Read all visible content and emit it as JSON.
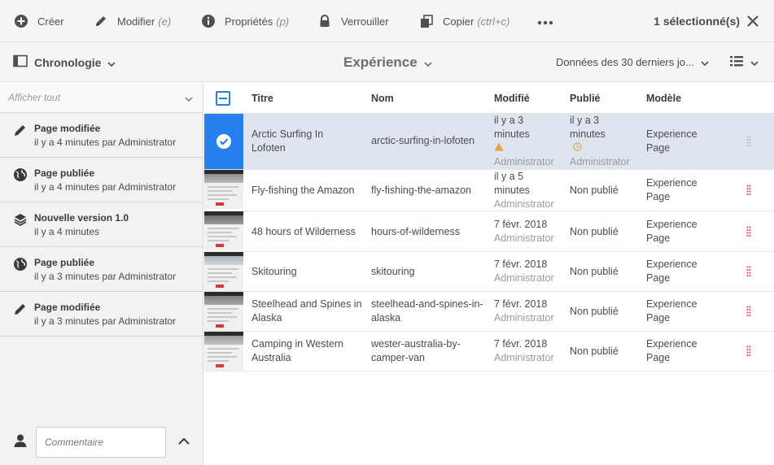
{
  "actionbar": {
    "create": {
      "label": "Créer",
      "shortcut": ""
    },
    "edit": {
      "label": "Modifier",
      "shortcut": "(e)"
    },
    "properties": {
      "label": "Propriétés",
      "shortcut": "(p)"
    },
    "lock": {
      "label": "Verrouiller",
      "shortcut": ""
    },
    "copy": {
      "label": "Copier",
      "shortcut": "(ctrl+c)"
    },
    "more_icon": "more-icon",
    "selection_count": "1 sélectionné(s)",
    "close_icon": "close-icon"
  },
  "subbar": {
    "rail_label": "Chronologie",
    "breadcrumb": "Expérience",
    "date_filter": "Données des 30 derniers jo...",
    "view_icon": "list-view-icon"
  },
  "rail": {
    "filter_label": "Afficher tout",
    "events": [
      {
        "icon": "pencil-icon",
        "title": "Page modifiée",
        "detail": "il y a 4 minutes par Administrator"
      },
      {
        "icon": "globe-icon",
        "title": "Page publiée",
        "detail": "il y a 4 minutes par Administrator"
      },
      {
        "icon": "layers-icon",
        "title": "Nouvelle version 1.0",
        "detail": "il y a 4 minutes"
      },
      {
        "icon": "globe-icon",
        "title": "Page publiée",
        "detail": "il y a 3 minutes par Administrator"
      },
      {
        "icon": "pencil-icon",
        "title": "Page modifiée",
        "detail": "il y a 3 minutes par Administrator"
      }
    ],
    "comment_placeholder": "Commentaire"
  },
  "table": {
    "headers": {
      "title": "Titre",
      "name": "Nom",
      "modified": "Modifié",
      "published": "Publié",
      "template": "Modèle"
    },
    "rows": [
      {
        "title1": "Arctic Surfing In",
        "title2": "Lofoten",
        "name1": "arctic-surfing-in-lofoten",
        "name2": "",
        "mod1": "il y a 3",
        "mod2": "minutes",
        "mod_by": "Administrator",
        "pub1": "il y a 3",
        "pub2": "minutes",
        "pub_by": "Administrator",
        "tpl1": "Experience",
        "tpl2": "Page"
      },
      {
        "title1": "Fly-fishing the Amazon",
        "title2": "",
        "name1": "fly-fishing-the-amazon",
        "name2": "",
        "mod1": "il y a 5",
        "mod2": "minutes",
        "mod_by": "Administrator",
        "pub": "Non publié",
        "tpl1": "Experience",
        "tpl2": "Page"
      },
      {
        "title1": "48 hours of Wilderness",
        "title2": "",
        "name1": "hours-of-wilderness",
        "name2": "",
        "mod1": "7 févr. 2018",
        "mod_by": "Administrator",
        "pub": "Non publié",
        "tpl1": "Experience",
        "tpl2": "Page"
      },
      {
        "title1": "Skitouring",
        "title2": "",
        "name1": "skitouring",
        "name2": "",
        "mod1": "7 févr. 2018",
        "mod_by": "Administrator",
        "pub": "Non publié",
        "tpl1": "Experience",
        "tpl2": "Page"
      },
      {
        "title1": "Steelhead and Spines in",
        "title2": "Alaska",
        "name1": "steelhead-and-spines-in-",
        "name2": "alaska",
        "mod1": "7 févr. 2018",
        "mod_by": "Administrator",
        "pub": "Non publié",
        "tpl1": "Experience",
        "tpl2": "Page"
      },
      {
        "title1": "Camping in Western",
        "title2": "Australia",
        "name1": "wester-australia-by-",
        "name2": "camper-van",
        "mod1": "7 févr. 2018",
        "mod_by": "Administrator",
        "pub": "Non publié",
        "tpl1": "Experience",
        "tpl2": "Page"
      }
    ]
  },
  "colors": {
    "accent": "#2680eb",
    "selected_row": "#dfe5ee",
    "warning": "#e8a53c"
  }
}
